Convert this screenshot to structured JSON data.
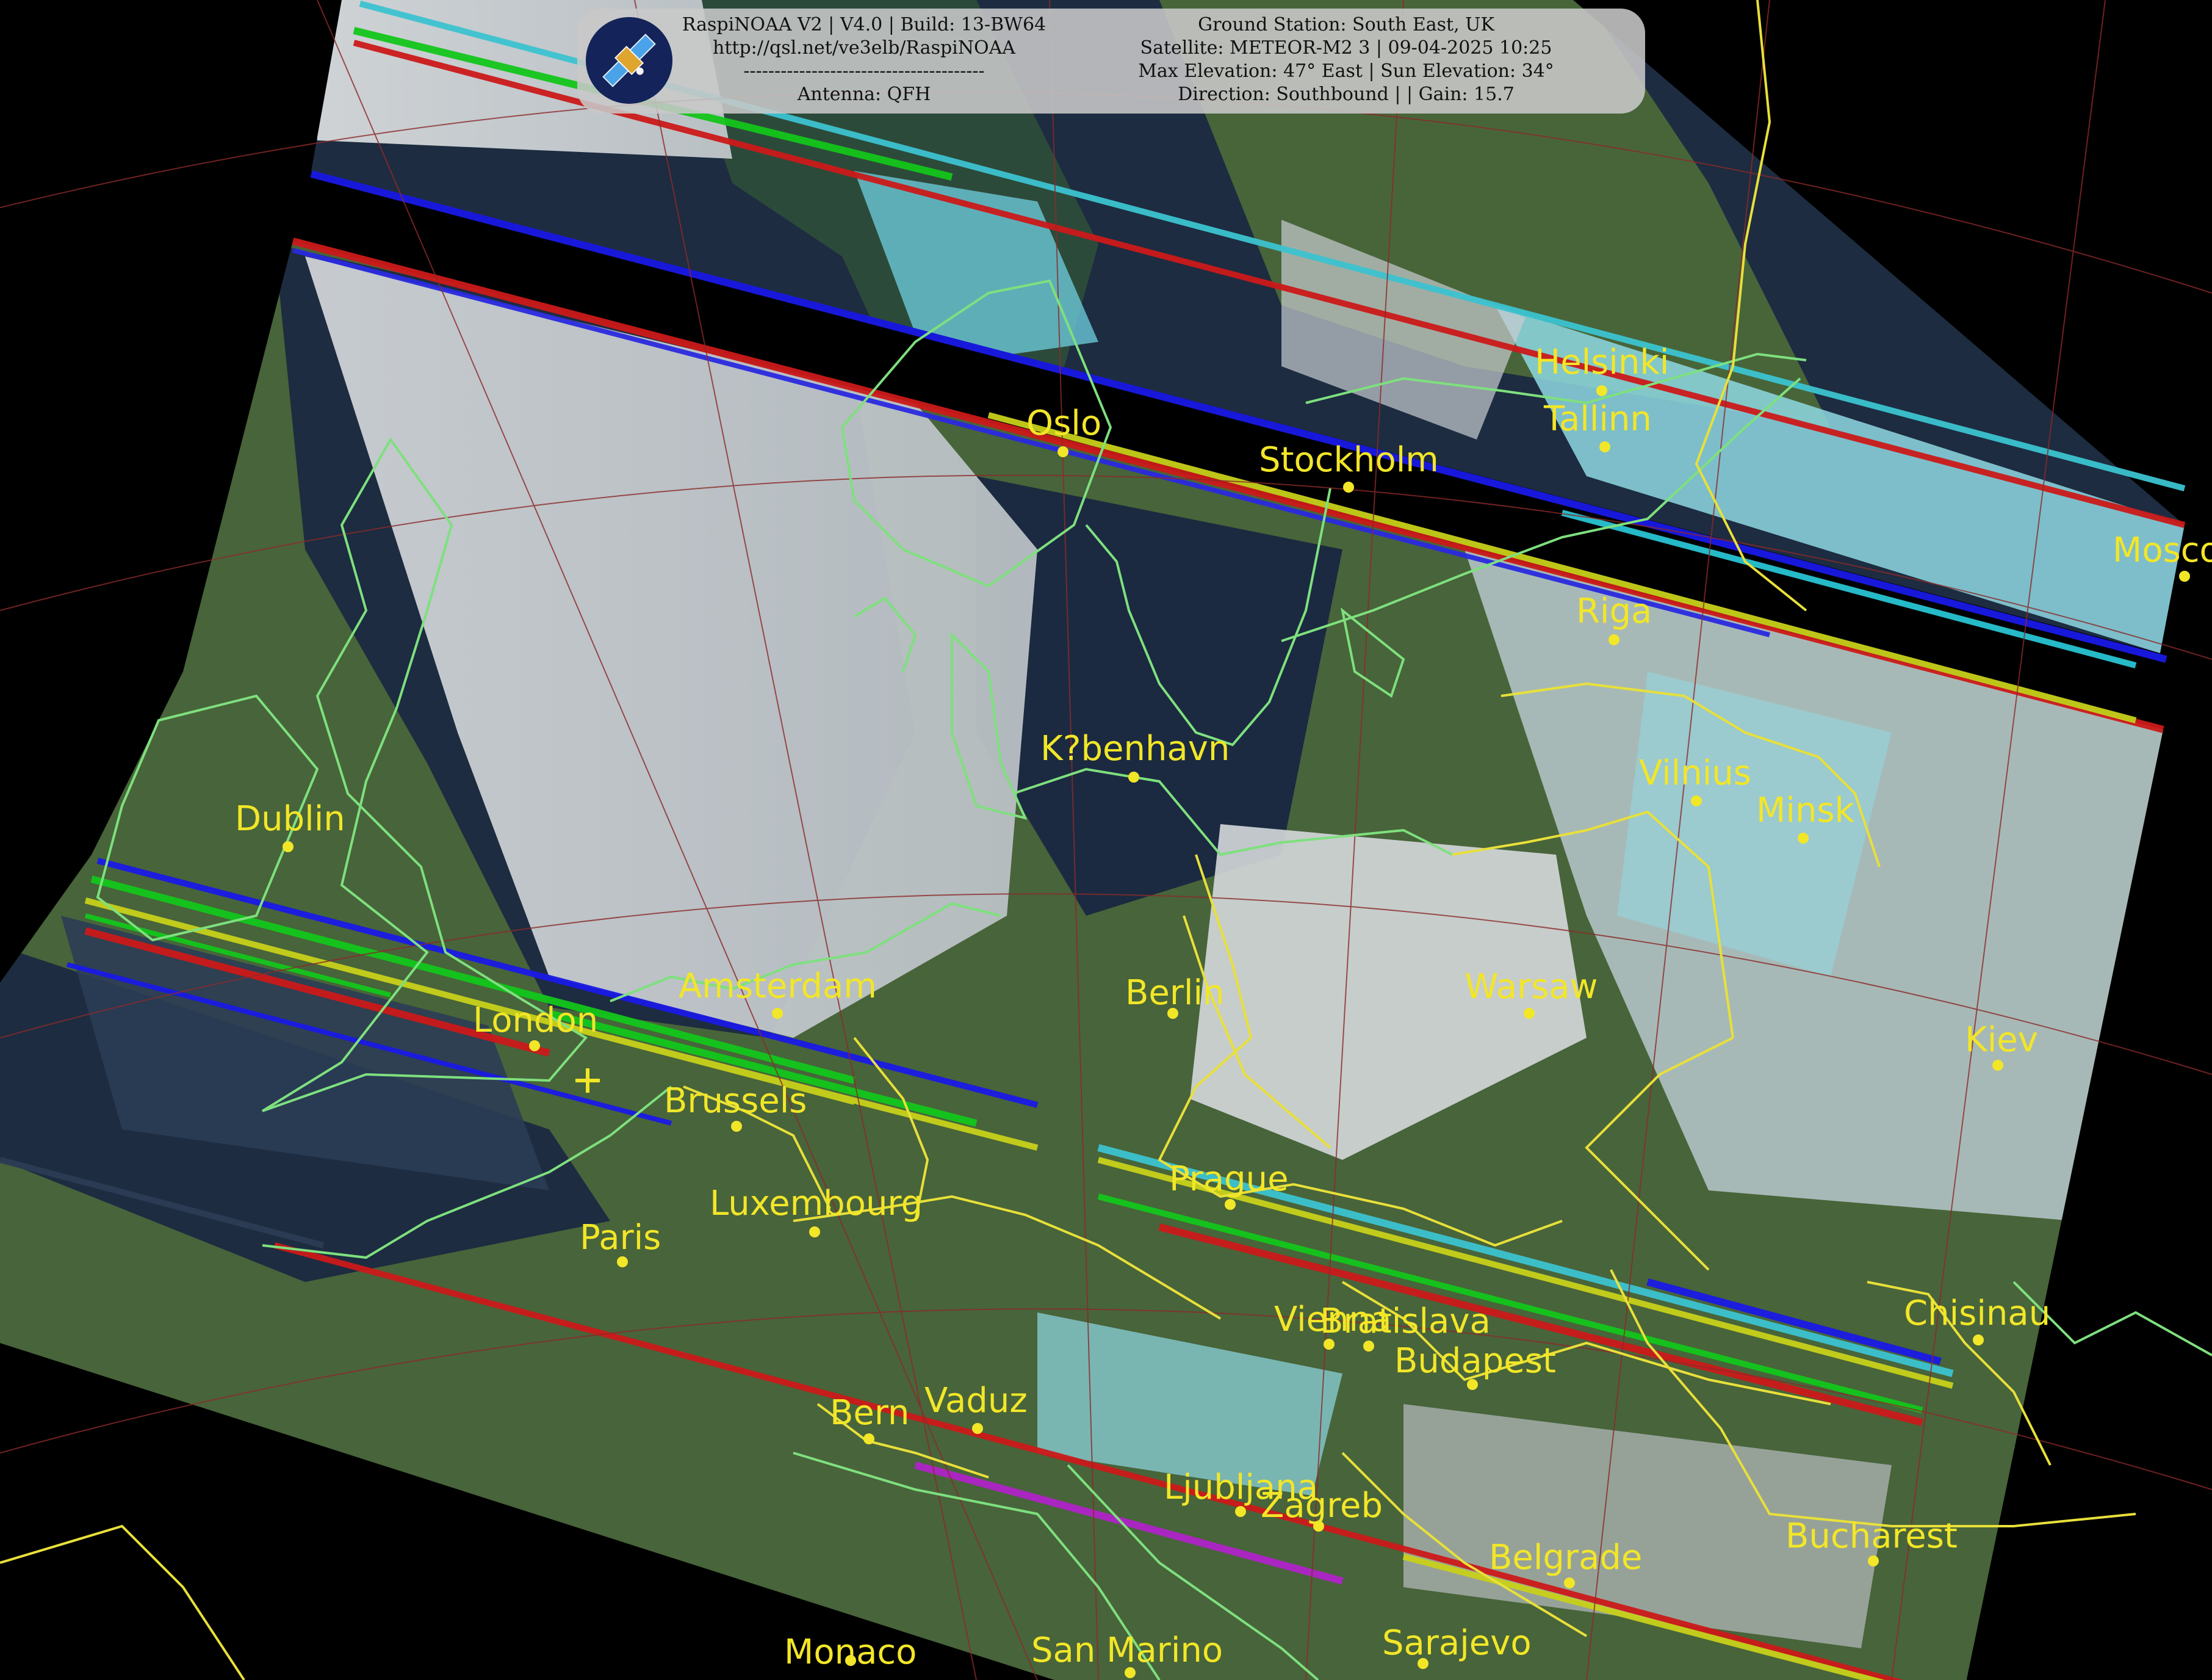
{
  "info": {
    "col1": [
      "RaspiNOAA V2 | V4.0 | Build: 13-BW64",
      "http://qsl.net/ve3elb/RaspiNOAA",
      "---------------------------------------",
      "Antenna: QFH"
    ],
    "col2": [
      "Ground Station: South East, UK",
      "Satellite: METEOR-M2 3 | 09-04-2025 10:25",
      "Max Elevation: 47° East | Sun Elevation: 34°",
      "Direction: Southbound | | Gain: 15.7"
    ]
  },
  "cities": [
    {
      "name": "Helsinki"
    },
    {
      "name": "Tallinn"
    },
    {
      "name": "Oslo"
    },
    {
      "name": "Stockholm"
    },
    {
      "name": "Mosco"
    },
    {
      "name": "Riga"
    },
    {
      "name": "K?benhavn"
    },
    {
      "name": "Vilnius"
    },
    {
      "name": "Minsk"
    },
    {
      "name": "Dublin"
    },
    {
      "name": "Amsterdam"
    },
    {
      "name": "Berlin"
    },
    {
      "name": "Warsaw"
    },
    {
      "name": "London"
    },
    {
      "name": "Kiev"
    },
    {
      "name": "Brussels"
    },
    {
      "name": "Prague"
    },
    {
      "name": "Luxembourg"
    },
    {
      "name": "Paris"
    },
    {
      "name": "Vienna"
    },
    {
      "name": "Bratislava"
    },
    {
      "name": "Chisinau"
    },
    {
      "name": "Budapest"
    },
    {
      "name": "Bern"
    },
    {
      "name": "Vaduz"
    },
    {
      "name": "Ljubljana"
    },
    {
      "name": "Zagreb"
    },
    {
      "name": "Bucharest"
    },
    {
      "name": "Belgrade"
    },
    {
      "name": "Monaco"
    },
    {
      "name": "San Marino"
    },
    {
      "name": "Sarajevo"
    }
  ],
  "colors": {
    "label": "#f2e628",
    "coastline": "#7ee07e",
    "border": "#e8e03a",
    "graticule": "#8b2a2a",
    "land": "#4d6b3a",
    "sea": "#1d2c40",
    "cloud": "#d3d7da",
    "snow": "#7fd8e6"
  }
}
